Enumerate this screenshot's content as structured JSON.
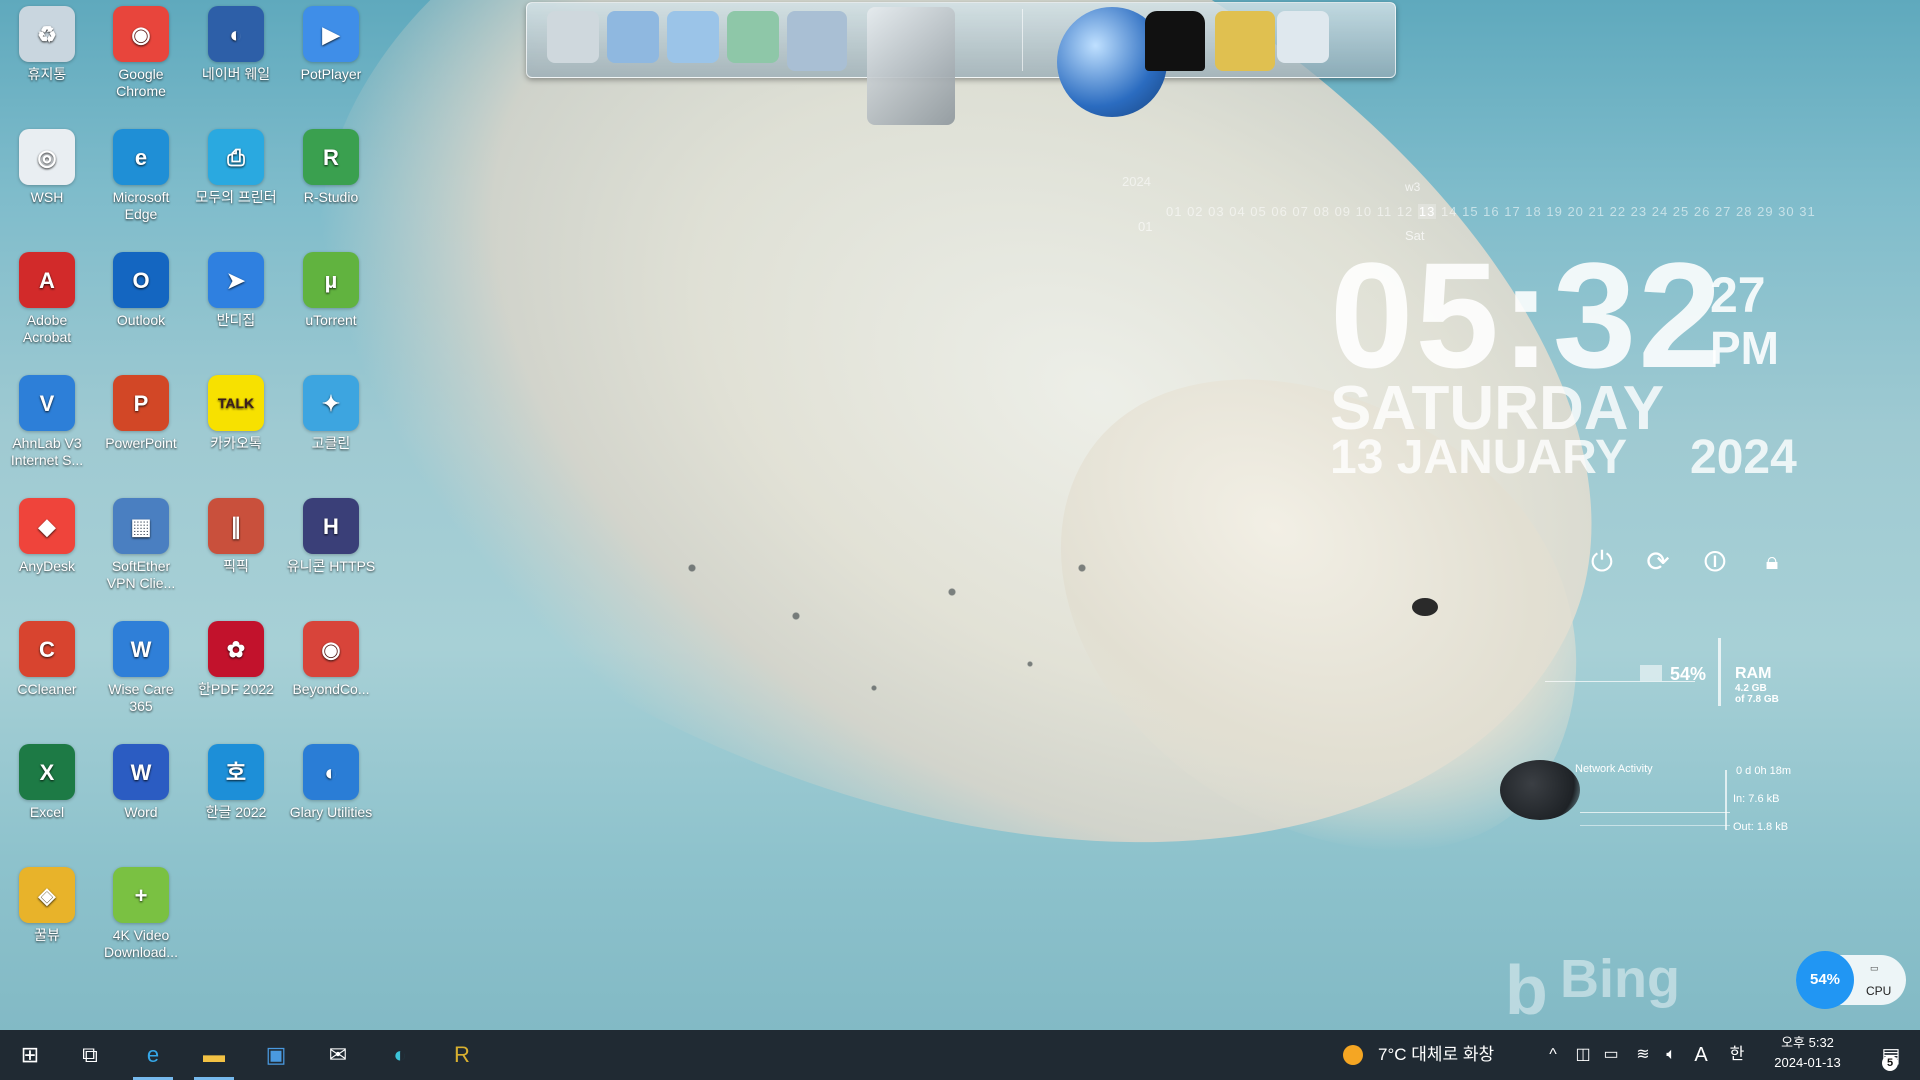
{
  "desktop_icons": [
    {
      "label": "휴지통",
      "icon": "recycle-bin-icon",
      "color": "#c9d6df",
      "glyph": "♻"
    },
    {
      "label": "Google Chrome",
      "icon": "chrome-icon",
      "color": "#e8453c",
      "glyph": "◉"
    },
    {
      "label": "네이버 웨일",
      "icon": "whale-browser-icon",
      "color": "#2d5fa8",
      "glyph": "◐"
    },
    {
      "label": "PotPlayer",
      "icon": "potplayer-icon",
      "color": "#3f8ee8",
      "glyph": "▶"
    },
    {
      "label": "WSH",
      "icon": "wsh-icon",
      "color": "#e9eef2",
      "glyph": "◎"
    },
    {
      "label": "Microsoft Edge",
      "icon": "edge-icon",
      "color": "#1f8fd6",
      "glyph": "e"
    },
    {
      "label": "모두의 프린터",
      "icon": "printer-icon",
      "color": "#2aa9e0",
      "glyph": "⎙"
    },
    {
      "label": "R-Studio",
      "icon": "r-studio-icon",
      "color": "#3aa04f",
      "glyph": "R"
    },
    {
      "label": "Adobe Acrobat",
      "icon": "acrobat-icon",
      "color": "#d22a2a",
      "glyph": "A"
    },
    {
      "label": "Outlook",
      "icon": "outlook-icon",
      "color": "#1466c1",
      "glyph": "O"
    },
    {
      "label": "반디집",
      "icon": "bandizip-icon",
      "color": "#2f80e0",
      "glyph": "➤"
    },
    {
      "label": "uTorrent",
      "icon": "utorrent-icon",
      "color": "#61b33f",
      "glyph": "µ"
    },
    {
      "label": "AhnLab V3 Internet S...",
      "icon": "ahnlab-v3-icon",
      "color": "#2d7fd8",
      "glyph": "V"
    },
    {
      "label": "PowerPoint",
      "icon": "powerpoint-icon",
      "color": "#d24726",
      "glyph": "P"
    },
    {
      "label": "카카오톡",
      "icon": "kakaotalk-icon",
      "color": "#f7e100",
      "glyph": "TALK"
    },
    {
      "label": "고클린",
      "icon": "goclean-icon",
      "color": "#3da5e0",
      "glyph": "✦"
    },
    {
      "label": "AnyDesk",
      "icon": "anydesk-icon",
      "color": "#ef443b",
      "glyph": "◆"
    },
    {
      "label": "SoftEther VPN Clie...",
      "icon": "softether-vpn-icon",
      "color": "#4a7fc1",
      "glyph": "▦"
    },
    {
      "label": "픽픽",
      "icon": "picpick-icon",
      "color": "#c9503c",
      "glyph": "∥"
    },
    {
      "label": "유니콘 HTTPS",
      "icon": "unicorn-https-icon",
      "color": "#3a3f78",
      "glyph": "H"
    },
    {
      "label": "CCleaner",
      "icon": "ccleaner-icon",
      "color": "#d8442f",
      "glyph": "C"
    },
    {
      "label": "Wise Care 365",
      "icon": "wise-care-icon",
      "color": "#2f7fd8",
      "glyph": "W"
    },
    {
      "label": "한PDF 2022",
      "icon": "hanpdf-icon",
      "color": "#c2122c",
      "glyph": "✿"
    },
    {
      "label": "BeyondCo...",
      "icon": "beyond-compare-icon",
      "color": "#d8443a",
      "glyph": "◉"
    },
    {
      "label": "Excel",
      "icon": "excel-icon",
      "color": "#1d7a45",
      "glyph": "X"
    },
    {
      "label": "Word",
      "icon": "word-icon",
      "color": "#2b5cc2",
      "glyph": "W"
    },
    {
      "label": "한글 2022",
      "icon": "hangul-icon",
      "color": "#1d8fd8",
      "glyph": "호"
    },
    {
      "label": "Glary Utilities",
      "icon": "glary-utilities-icon",
      "color": "#2a7dd6",
      "glyph": "◐"
    },
    {
      "label": "꿀뷰",
      "icon": "honeyview-icon",
      "color": "#e8b32a",
      "glyph": "◈"
    },
    {
      "label": "4K Video Download...",
      "icon": "4k-video-downloader-icon",
      "color": "#7ac142",
      "glyph": "+"
    }
  ],
  "dock": {
    "items": [
      {
        "icon": "computer-icon",
        "color": "#cfd8dd"
      },
      {
        "icon": "network-globe-icon",
        "color": "#8fb8e0"
      },
      {
        "icon": "folder-documents-icon",
        "color": "#9bc4e8"
      },
      {
        "icon": "folder-downloads-icon",
        "color": "#8ec7a8"
      },
      {
        "icon": "folder-drive-icon",
        "color": "#a9bfd4"
      },
      {
        "icon": "tools-icon",
        "color": "#bfc7cc"
      },
      {
        "icon": "globe-browser-icon",
        "color": "#3b78c6"
      },
      {
        "icon": "tshirt-icon",
        "color": "#111111"
      },
      {
        "icon": "hammer-icon",
        "color": "#e0c050"
      },
      {
        "icon": "recycle-bin-icon",
        "color": "#dfe8ee"
      }
    ]
  },
  "calendar": {
    "year": "2024",
    "week": "w3",
    "month": "01",
    "days_before": "01 02 03 04 05 06 07 08 09 10 11 12",
    "today": "13",
    "days_after": "14 15 16 17 18 19 20 21 22 23 24 25 26 27 28 29 30 31",
    "day_of_week": "Sat"
  },
  "clock": {
    "time": "05:32",
    "seconds": "27",
    "ampm": "PM",
    "weekday": "SATURDAY",
    "date": "13 JANUARY",
    "year": "2024"
  },
  "power_buttons": [
    {
      "icon": "power-icon",
      "glyph": "⏻"
    },
    {
      "icon": "restart-icon",
      "glyph": "⟳"
    },
    {
      "icon": "sleep-icon",
      "glyph": "⏼"
    },
    {
      "icon": "lock-icon",
      "glyph": "🔒︎"
    }
  ],
  "ram": {
    "percent": "54%",
    "label": "RAM",
    "used": "4.2 GB",
    "total": "of 7.8 GB"
  },
  "network": {
    "title": "Network Activity",
    "uptime": "0 d 0h 18m",
    "in": "In: 7.6 kB",
    "out": "Out: 1.8 kB"
  },
  "watermark": "Bing",
  "cpu_widget": {
    "percent": "54%",
    "label": "CPU"
  },
  "taskbar": {
    "pinned": [
      {
        "icon": "windows-start-icon",
        "glyph": "⊞",
        "color": "#ffffff"
      },
      {
        "icon": "task-view-icon",
        "glyph": "⧉",
        "color": "#ffffff"
      },
      {
        "icon": "edge-icon",
        "glyph": "e",
        "color": "#35a7e8"
      },
      {
        "icon": "file-explorer-icon",
        "glyph": "▬",
        "color": "#f3c244"
      },
      {
        "icon": "microsoft-store-icon",
        "glyph": "▣",
        "color": "#4a9ae0"
      },
      {
        "icon": "mail-icon",
        "glyph": "✉",
        "color": "#ffffff"
      },
      {
        "icon": "whale-browser-icon",
        "glyph": "◐",
        "color": "#3bc3d8"
      },
      {
        "icon": "r-app-icon",
        "glyph": "R",
        "color": "#d8b030"
      }
    ],
    "weather": {
      "icon": "weather-cloudy-icon",
      "text": "7°C  대체로 화창"
    },
    "tray": [
      {
        "icon": "chevron-up-icon",
        "glyph": "^"
      },
      {
        "icon": "meet-now-icon",
        "glyph": "◫"
      },
      {
        "icon": "battery-icon",
        "glyph": "▭"
      },
      {
        "icon": "wifi-icon",
        "glyph": "≋"
      },
      {
        "icon": "speaker-icon",
        "glyph": "🔈︎"
      },
      {
        "icon": "ime-a-icon",
        "glyph": "A"
      },
      {
        "icon": "ime-hangul-icon",
        "glyph": "한"
      }
    ],
    "clock_time": "오후 5:32",
    "clock_date": "2024-01-13",
    "notification_count": "5"
  }
}
